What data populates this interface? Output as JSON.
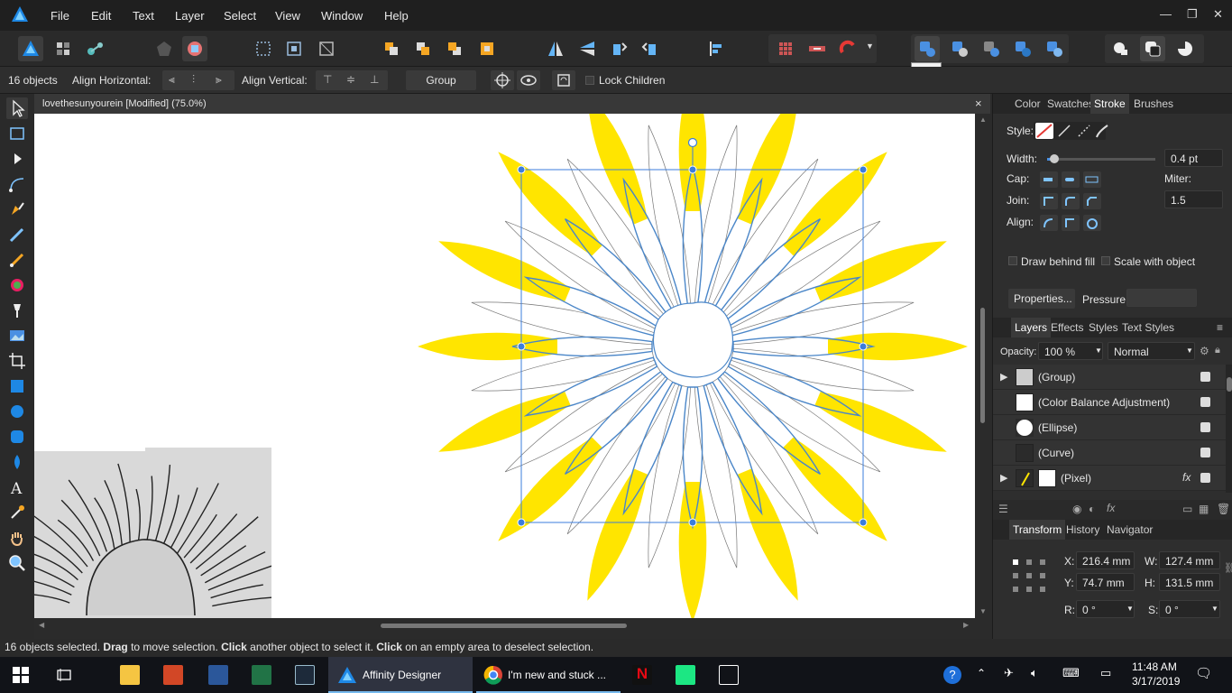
{
  "menu": [
    "File",
    "Edit",
    "Text",
    "Layer",
    "Select",
    "View",
    "Window",
    "Help"
  ],
  "tooltip": "Add",
  "context": {
    "objects": "16 objects",
    "align_h": "Align Horizontal:",
    "align_v": "Align Vertical:",
    "group": "Group",
    "lock_children": "Lock Children"
  },
  "document": {
    "title": "lovethesunyourein [Modified] (75.0%)",
    "close": "×"
  },
  "stroke_panel": {
    "tabs": [
      "Color",
      "Swatches",
      "Stroke",
      "Brushes"
    ],
    "active_tab": "Stroke",
    "style_label": "Style:",
    "width_label": "Width:",
    "width_value": "0.4 pt",
    "cap_label": "Cap:",
    "miter_label": "Miter:",
    "miter_value": "1.5",
    "join_label": "Join:",
    "align_label": "Align:",
    "draw_behind": "Draw behind fill",
    "scale_with": "Scale with object",
    "properties": "Properties...",
    "pressure": "Pressure:"
  },
  "layers_panel": {
    "tabs": [
      "Layers",
      "Effects",
      "Styles",
      "Text Styles"
    ],
    "active_tab": "Layers",
    "opacity_label": "Opacity:",
    "opacity_value": "100 %",
    "blend": "Normal",
    "layers": [
      {
        "name": "(Group)",
        "expandable": true
      },
      {
        "name": "(Color Balance Adjustment)",
        "expandable": false
      },
      {
        "name": "(Ellipse)",
        "expandable": false
      },
      {
        "name": "(Curve)",
        "expandable": false
      },
      {
        "name": "(Pixel)",
        "expandable": true
      }
    ]
  },
  "transform_panel": {
    "tabs": [
      "Transform",
      "History",
      "Navigator"
    ],
    "active_tab": "Transform",
    "x_label": "X:",
    "x_value": "216.4 mm",
    "w_label": "W:",
    "w_value": "127.4 mm",
    "y_label": "Y:",
    "y_value": "74.7 mm",
    "h_label": "H:",
    "h_value": "131.5 mm",
    "r_label": "R:",
    "r_value": "0 °",
    "s_label": "S:",
    "s_value": "0 °"
  },
  "status": {
    "a": "16 objects selected. ",
    "b": "Drag",
    "c": " to move selection. ",
    "d": "Click",
    "e": " another object to select it. ",
    "f": "Click",
    "g": " on an empty area to deselect selection."
  },
  "taskbar": {
    "affinity": "Affinity Designer",
    "chrome": "I'm new and stuck ...",
    "time": "11:48 AM",
    "date": "3/17/2019"
  },
  "colors": {
    "accent": "#4a90e2",
    "sun_yellow": "#ffe500",
    "selection": "#3b7ddd"
  }
}
